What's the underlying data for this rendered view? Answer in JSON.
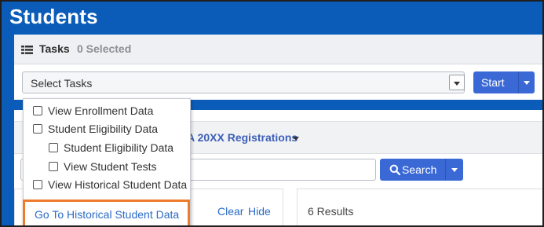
{
  "page": {
    "title": "Students"
  },
  "tasks": {
    "title": "Tasks",
    "selected_count": "0 Selected",
    "select_value": "Select Tasks",
    "start_label": "Start"
  },
  "registration": {
    "label": "CA 20XX Registrations"
  },
  "search": {
    "button_label": "Search",
    "input_value": ""
  },
  "filters": {
    "clear_label": "Clear",
    "hide_label": "Hide"
  },
  "results": {
    "text": "6 Results"
  },
  "dropdown": {
    "items": [
      {
        "label": "View Enrollment Data",
        "checked": false,
        "indent": 0
      },
      {
        "label": "Student Eligibility Data",
        "checked": false,
        "indent": 0
      },
      {
        "label": "Student Eligibility Data",
        "checked": false,
        "indent": 1
      },
      {
        "label": "View Student Tests",
        "checked": false,
        "indent": 1
      },
      {
        "label": "View Historical Student Data",
        "checked": false,
        "indent": 0
      }
    ],
    "action_label": "Go To Historical Student Data"
  },
  "colors": {
    "header_blue": "#0b5cb8",
    "button_blue": "#3a69d6",
    "link_blue": "#2a6bc6",
    "highlight_orange": "#ee7b2c"
  },
  "icons": {
    "tasks": "list-icon",
    "search": "search-icon",
    "caret": "chevron-down-icon"
  }
}
